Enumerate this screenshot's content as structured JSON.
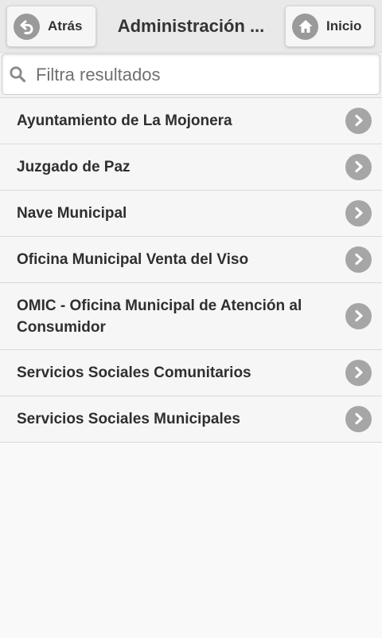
{
  "header": {
    "back_label": "Atrás",
    "title": "Administración ...",
    "home_label": "Inicio"
  },
  "search": {
    "placeholder": "Filtra resultados",
    "value": ""
  },
  "list": {
    "items": [
      {
        "label": "Ayuntamiento de La Mojonera"
      },
      {
        "label": "Juzgado de Paz"
      },
      {
        "label": "Nave Municipal"
      },
      {
        "label": "Oficina Municipal Venta del Viso"
      },
      {
        "label": "OMIC - Oficina Municipal de Atención al Consumidor"
      },
      {
        "label": "Servicios Sociales Comunitarios"
      },
      {
        "label": "Servicios Sociales Municipales"
      }
    ]
  },
  "icons": {
    "back": "arrow-back-icon",
    "home": "home-icon",
    "search": "search-icon",
    "row": "chevron-right-icon"
  },
  "colors": {
    "header_bg": "#e9e9e9",
    "icon_circle": "#9a9a9a",
    "text": "#2f2f2f"
  }
}
